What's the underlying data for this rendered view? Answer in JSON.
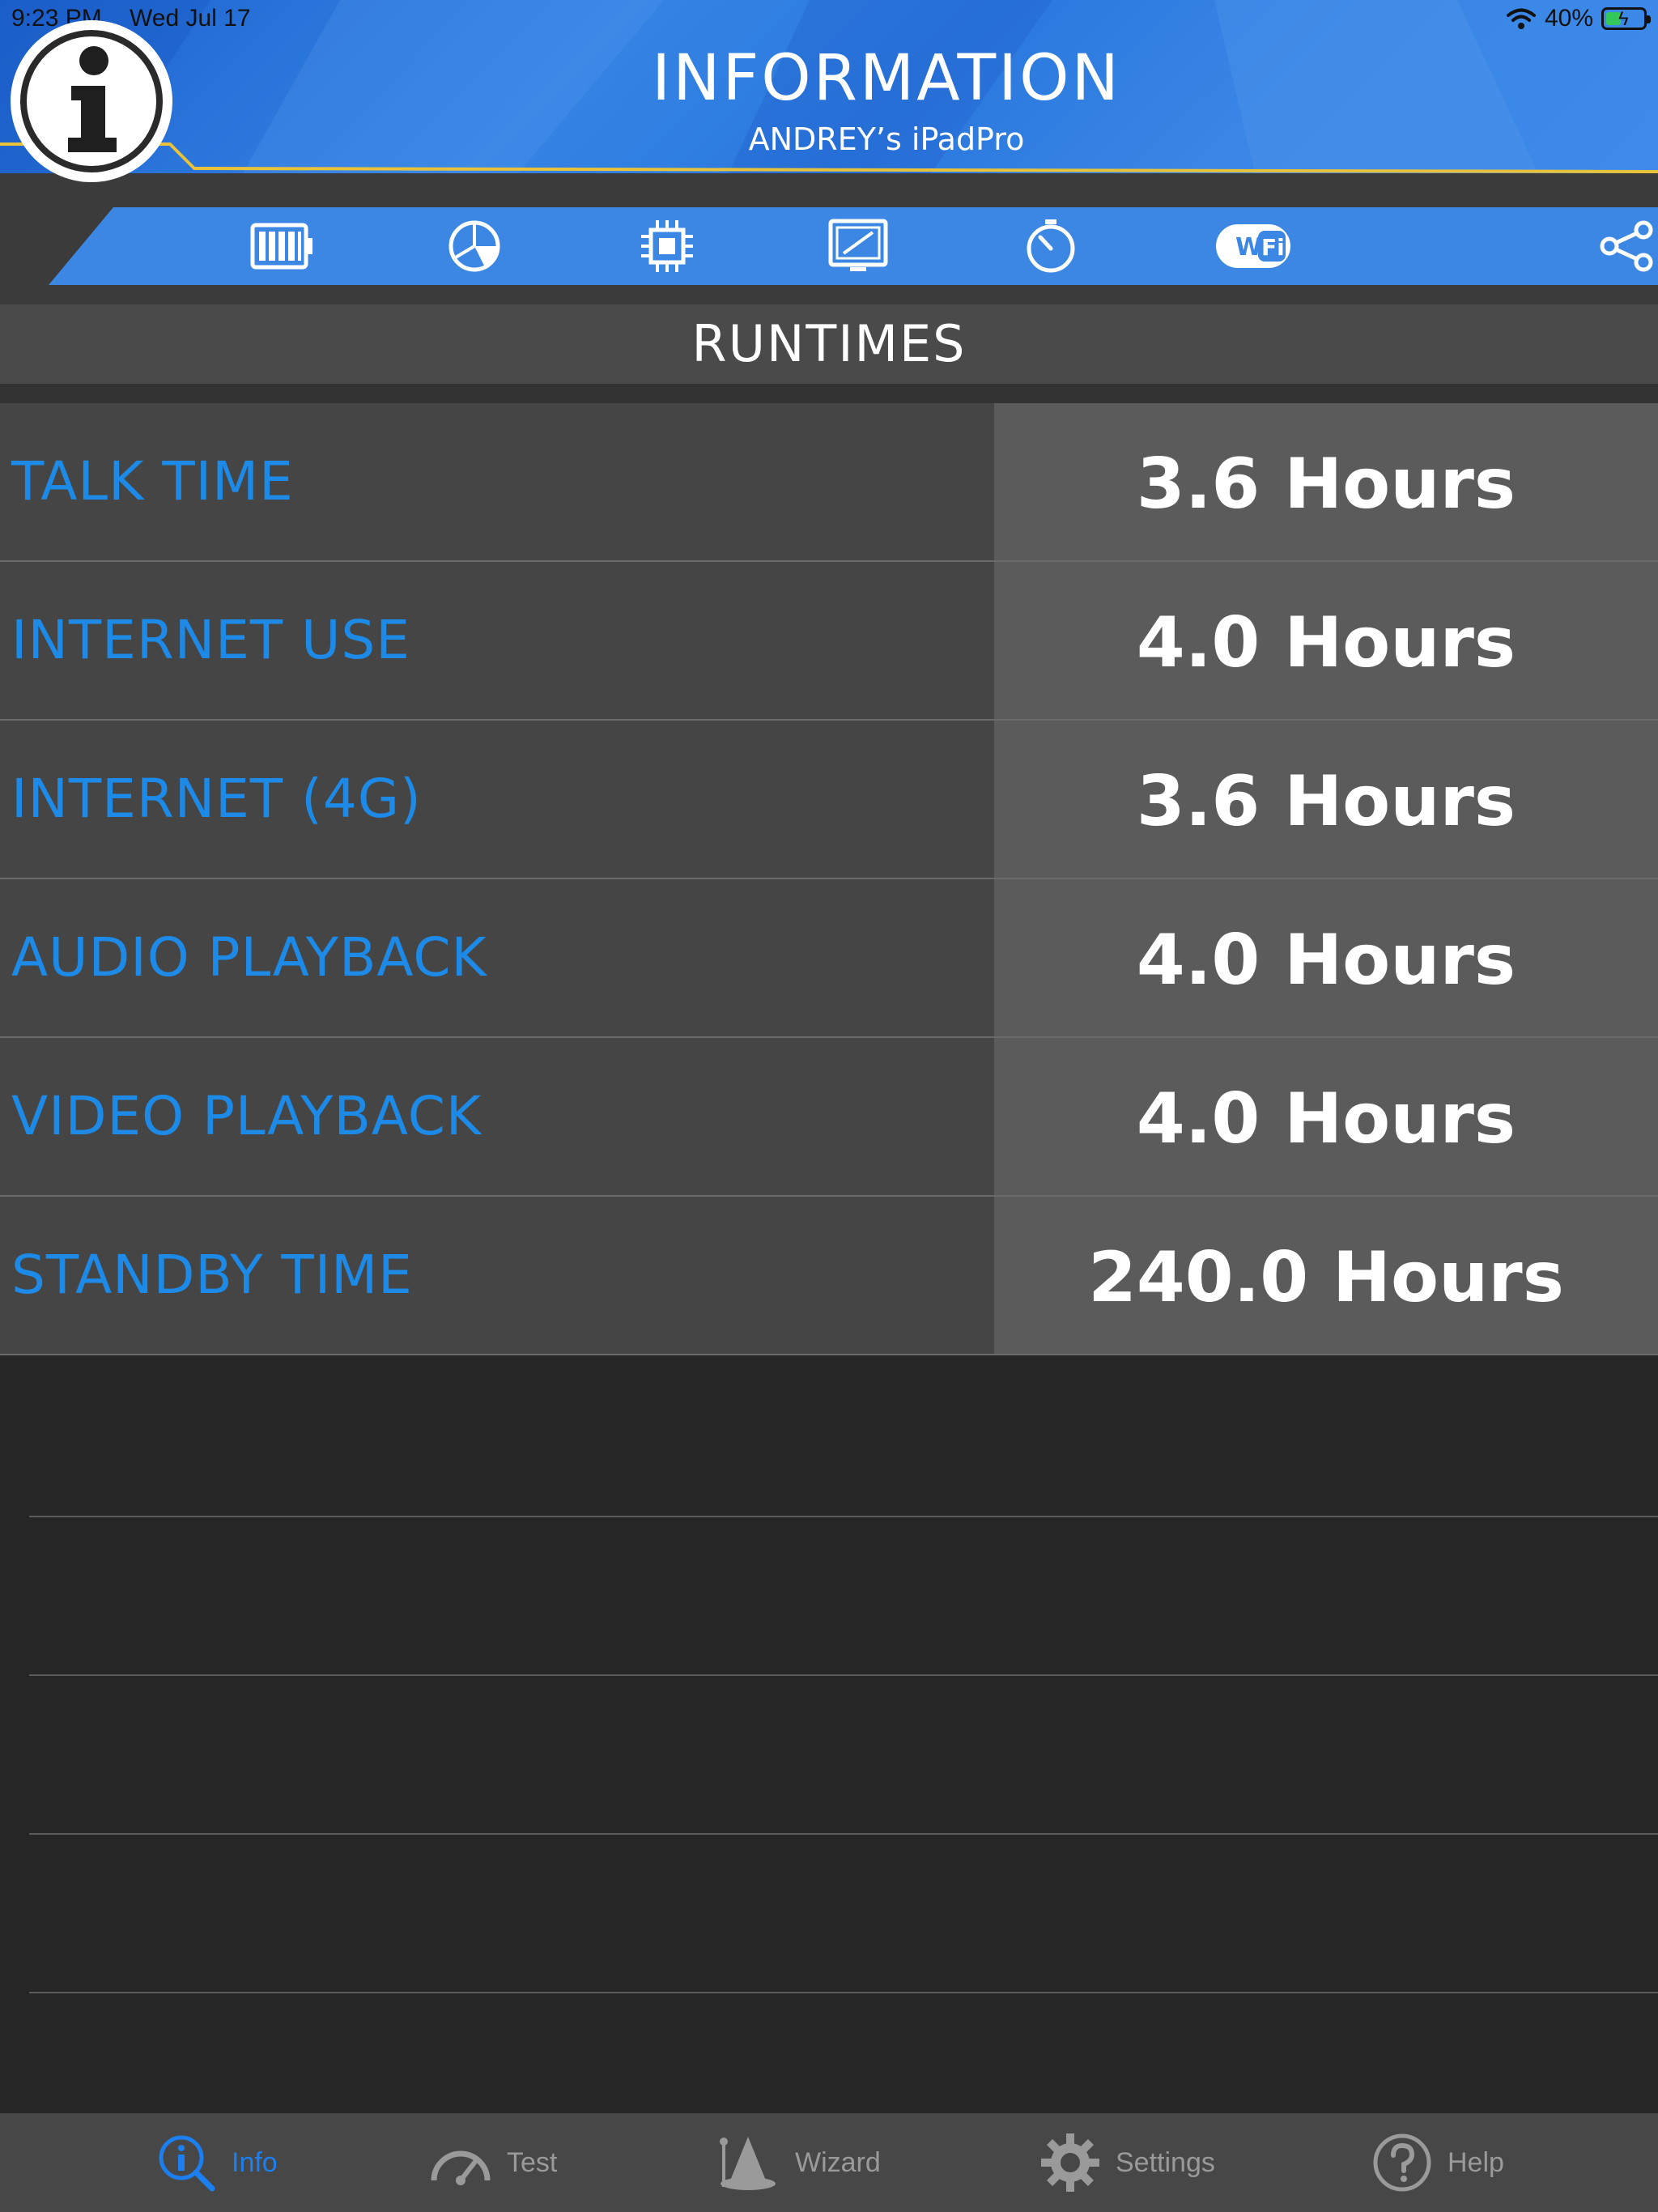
{
  "status_bar": {
    "time": "9:23 PM",
    "date": "Wed Jul 17",
    "battery_percent": "40%",
    "battery_level": 0.4
  },
  "header": {
    "title": "INFORMATION",
    "subtitle": "ANDREY’s iPadPro"
  },
  "toolbar": {
    "icons": [
      "battery-icon",
      "pie-chart-icon",
      "cpu-chip-icon",
      "display-icon",
      "timer-icon",
      "wifi-icon",
      "share-icon"
    ]
  },
  "section": {
    "title": "RUNTIMES"
  },
  "runtimes": [
    {
      "label": "TALK TIME",
      "value": "3.6 Hours"
    },
    {
      "label": "INTERNET USE",
      "value": "4.0 Hours"
    },
    {
      "label": "INTERNET (4G)",
      "value": "3.6 Hours"
    },
    {
      "label": "AUDIO PLAYBACK",
      "value": "4.0 Hours"
    },
    {
      "label": "VIDEO PLAYBACK",
      "value": "4.0 Hours"
    },
    {
      "label": "STANDBY TIME",
      "value": "240.0 Hours"
    }
  ],
  "tabbar": {
    "tabs": [
      {
        "label": "Info",
        "icon": "info-search-icon",
        "active": true
      },
      {
        "label": "Test",
        "icon": "speedometer-icon",
        "active": false
      },
      {
        "label": "Wizard",
        "icon": "wizard-hat-icon",
        "active": false
      },
      {
        "label": "Settings",
        "icon": "gear-icon",
        "active": false
      },
      {
        "label": "Help",
        "icon": "question-icon",
        "active": false
      }
    ]
  },
  "colors": {
    "accent_blue": "#1c8ae6",
    "header_blue": "#3584e4",
    "tab_active": "#1c7ff0",
    "tab_inactive": "#9a9a9a",
    "battery_green": "#34c759"
  }
}
